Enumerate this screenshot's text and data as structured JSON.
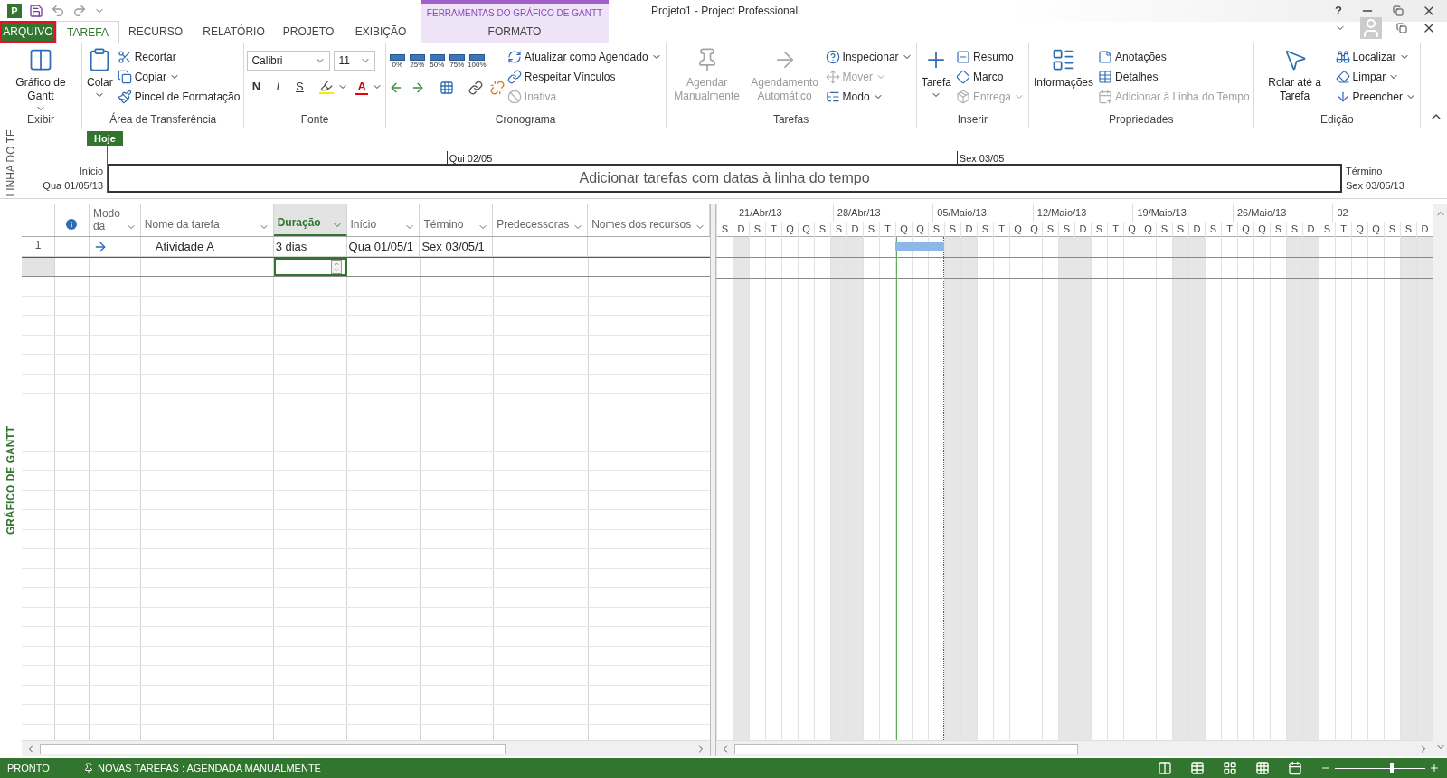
{
  "app_icon_letter": "P",
  "window": {
    "title": "Projeto1 - Project Professional",
    "help": "?"
  },
  "contextual_group": "FERRAMENTAS DO GRÁFICO DE GANTT",
  "tabs": [
    {
      "label": "ARQUIVO",
      "kind": "file",
      "selected": false
    },
    {
      "label": "TAREFA",
      "kind": "normal",
      "selected": true
    },
    {
      "label": "RECURSO",
      "kind": "normal",
      "selected": false
    },
    {
      "label": "RELATÓRIO",
      "kind": "normal",
      "selected": false
    },
    {
      "label": "PROJETO",
      "kind": "normal",
      "selected": false
    },
    {
      "label": "EXIBIÇÃO",
      "kind": "normal",
      "selected": false
    },
    {
      "label": "FORMATO",
      "kind": "contextual",
      "selected": false
    }
  ],
  "ribbon": [
    {
      "label": "Exibir",
      "large": [
        {
          "label": "Gráfico de Gantt",
          "dropdown": true,
          "disabled": false
        }
      ]
    },
    {
      "label": "Área de Transferência",
      "large": [
        {
          "label": "Colar",
          "dropdown": true,
          "disabled": false
        }
      ],
      "small": [
        {
          "label": "Recortar",
          "dropdown": false,
          "disabled": false
        },
        {
          "label": "Copiar",
          "dropdown": true,
          "disabled": false
        },
        {
          "label": "Pincel de Formatação",
          "dropdown": false,
          "disabled": false
        }
      ]
    },
    {
      "label": "Fonte",
      "font": {
        "name": "Calibri",
        "size": "11",
        "styles": [
          "N",
          "I",
          "S"
        ],
        "color_letter": "A"
      }
    },
    {
      "label": "Cronograma",
      "percent": [
        "0%",
        "25%",
        "50%",
        "75%",
        "100%"
      ],
      "small": [
        {
          "label": "Atualizar como Agendado",
          "dropdown": true,
          "disabled": false
        },
        {
          "label": "Respeitar Vínculos",
          "dropdown": false,
          "disabled": false
        },
        {
          "label": "Inativa",
          "dropdown": false,
          "disabled": true
        }
      ]
    },
    {
      "label": "Tarefas",
      "large": [
        {
          "label": "Agendar Manualmente",
          "dropdown": false,
          "disabled": true
        },
        {
          "label": "Agendamento Automático",
          "dropdown": false,
          "disabled": true
        }
      ],
      "small": [
        {
          "label": "Inspecionar",
          "dropdown": true,
          "disabled": false
        },
        {
          "label": "Mover",
          "dropdown": true,
          "disabled": true
        },
        {
          "label": "Modo",
          "dropdown": true,
          "disabled": false
        }
      ]
    },
    {
      "label": "Inserir",
      "large": [
        {
          "label": "Tarefa",
          "dropdown": true,
          "disabled": false
        }
      ],
      "small": [
        {
          "label": "Resumo",
          "dropdown": false,
          "disabled": false
        },
        {
          "label": "Marco",
          "dropdown": false,
          "disabled": false
        },
        {
          "label": "Entrega",
          "dropdown": true,
          "disabled": true
        }
      ]
    },
    {
      "label": "Propriedades",
      "large": [
        {
          "label": "Informações",
          "dropdown": false,
          "disabled": false
        }
      ],
      "small": [
        {
          "label": "Anotações",
          "dropdown": false,
          "disabled": false
        },
        {
          "label": "Detalhes",
          "dropdown": false,
          "disabled": false
        },
        {
          "label": "Adicionar à Linha do Tempo",
          "dropdown": false,
          "disabled": true
        }
      ]
    },
    {
      "label": "Edição",
      "large": [
        {
          "label": "Rolar até a Tarefa",
          "dropdown": false,
          "disabled": false
        }
      ],
      "small": [
        {
          "label": "Localizar",
          "dropdown": true,
          "disabled": false
        },
        {
          "label": "Limpar",
          "dropdown": true,
          "disabled": false
        },
        {
          "label": "Preencher",
          "dropdown": true,
          "disabled": false
        }
      ]
    }
  ],
  "timeline": {
    "side_label": "LINHA DO TE",
    "today": "Hoje",
    "start_label": "Início",
    "start_date": "Qua 01/05/13",
    "ticks": [
      "Qui 02/05",
      "Sex 03/05"
    ],
    "placeholder": "Adicionar tarefas com datas à linha do tempo",
    "end_label": "Término",
    "end_date": "Sex 03/05/13"
  },
  "view_label": "GRÁFICO DE GANTT",
  "table": {
    "columns": [
      {
        "label": "Modo da",
        "selected": false
      },
      {
        "label": "Nome da tarefa",
        "selected": false
      },
      {
        "label": "Duração",
        "selected": true
      },
      {
        "label": "Início",
        "selected": false
      },
      {
        "label": "Término",
        "selected": false
      },
      {
        "label": "Predecessoras",
        "selected": false
      },
      {
        "label": "Nomes dos recursos",
        "selected": false
      }
    ],
    "rows": [
      {
        "id": "1",
        "name": "Atividade A",
        "duration": "3 dias",
        "start": "Qua 01/05/1",
        "finish": "Sex 03/05/1"
      }
    ],
    "new_row": {
      "selected": true
    }
  },
  "gantt": {
    "weeks": [
      "21/Abr/13",
      "28/Abr/13",
      "05/Maio/13",
      "12/Maio/13",
      "19/Maio/13",
      "26/Maio/13",
      "02"
    ],
    "days": [
      {
        "label": "S",
        "weekend": false,
        "task": false,
        "today": false,
        "finish": false
      },
      {
        "label": "D",
        "weekend": true,
        "task": false,
        "today": false,
        "finish": false
      },
      {
        "label": "S",
        "weekend": false,
        "task": false,
        "today": false,
        "finish": false
      },
      {
        "label": "T",
        "weekend": false,
        "task": false,
        "today": false,
        "finish": false
      },
      {
        "label": "Q",
        "weekend": false,
        "task": false,
        "today": false,
        "finish": false
      },
      {
        "label": "Q",
        "weekend": false,
        "task": false,
        "today": false,
        "finish": false
      },
      {
        "label": "S",
        "weekend": false,
        "task": false,
        "today": false,
        "finish": false
      },
      {
        "label": "S",
        "weekend": true,
        "task": false,
        "today": false,
        "finish": false
      },
      {
        "label": "D",
        "weekend": true,
        "task": false,
        "today": false,
        "finish": false
      },
      {
        "label": "S",
        "weekend": false,
        "task": false,
        "today": false,
        "finish": false
      },
      {
        "label": "T",
        "weekend": false,
        "task": false,
        "today": false,
        "finish": false
      },
      {
        "label": "Q",
        "weekend": false,
        "task": true,
        "today": true,
        "finish": false
      },
      {
        "label": "Q",
        "weekend": false,
        "task": true,
        "today": false,
        "finish": false
      },
      {
        "label": "S",
        "weekend": false,
        "task": true,
        "today": false,
        "finish": true
      },
      {
        "label": "S",
        "weekend": true,
        "task": false,
        "today": false,
        "finish": false
      },
      {
        "label": "D",
        "weekend": true,
        "task": false,
        "today": false,
        "finish": false
      },
      {
        "label": "S",
        "weekend": false,
        "task": false,
        "today": false,
        "finish": false
      },
      {
        "label": "T",
        "weekend": false,
        "task": false,
        "today": false,
        "finish": false
      },
      {
        "label": "Q",
        "weekend": false,
        "task": false,
        "today": false,
        "finish": false
      },
      {
        "label": "Q",
        "weekend": false,
        "task": false,
        "today": false,
        "finish": false
      },
      {
        "label": "S",
        "weekend": false,
        "task": false,
        "today": false,
        "finish": false
      },
      {
        "label": "S",
        "weekend": true,
        "task": false,
        "today": false,
        "finish": false
      },
      {
        "label": "D",
        "weekend": true,
        "task": false,
        "today": false,
        "finish": false
      },
      {
        "label": "S",
        "weekend": false,
        "task": false,
        "today": false,
        "finish": false
      },
      {
        "label": "T",
        "weekend": false,
        "task": false,
        "today": false,
        "finish": false
      },
      {
        "label": "Q",
        "weekend": false,
        "task": false,
        "today": false,
        "finish": false
      },
      {
        "label": "Q",
        "weekend": false,
        "task": false,
        "today": false,
        "finish": false
      },
      {
        "label": "S",
        "weekend": false,
        "task": false,
        "today": false,
        "finish": false
      },
      {
        "label": "S",
        "weekend": true,
        "task": false,
        "today": false,
        "finish": false
      },
      {
        "label": "D",
        "weekend": true,
        "task": false,
        "today": false,
        "finish": false
      },
      {
        "label": "S",
        "weekend": false,
        "task": false,
        "today": false,
        "finish": false
      },
      {
        "label": "T",
        "weekend": false,
        "task": false,
        "today": false,
        "finish": false
      },
      {
        "label": "Q",
        "weekend": false,
        "task": false,
        "today": false,
        "finish": false
      },
      {
        "label": "Q",
        "weekend": false,
        "task": false,
        "today": false,
        "finish": false
      },
      {
        "label": "S",
        "weekend": false,
        "task": false,
        "today": false,
        "finish": false
      },
      {
        "label": "S",
        "weekend": true,
        "task": false,
        "today": false,
        "finish": false
      },
      {
        "label": "D",
        "weekend": true,
        "task": false,
        "today": false,
        "finish": false
      },
      {
        "label": "S",
        "weekend": false,
        "task": false,
        "today": false,
        "finish": false
      },
      {
        "label": "T",
        "weekend": false,
        "task": false,
        "today": false,
        "finish": false
      },
      {
        "label": "Q",
        "weekend": false,
        "task": false,
        "today": false,
        "finish": false
      },
      {
        "label": "Q",
        "weekend": false,
        "task": false,
        "today": false,
        "finish": false
      },
      {
        "label": "S",
        "weekend": false,
        "task": false,
        "today": false,
        "finish": false
      },
      {
        "label": "S",
        "weekend": true,
        "task": false,
        "today": false,
        "finish": false
      },
      {
        "label": "D",
        "weekend": true,
        "task": false,
        "today": false,
        "finish": false
      }
    ]
  },
  "status_bar": {
    "ready": "PRONTO",
    "new_tasks": "NOVAS TAREFAS : AGENDADA MANUALMENTE",
    "zoom": {
      "level": 0.63
    }
  }
}
